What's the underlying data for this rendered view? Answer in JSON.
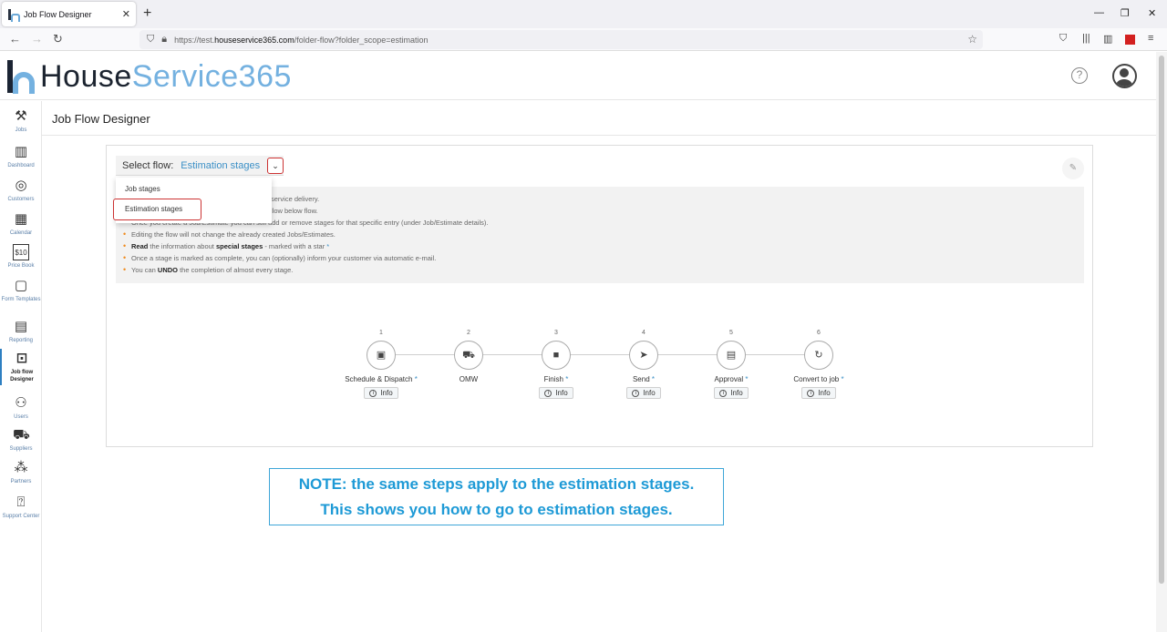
{
  "browser": {
    "tab_title": "Job Flow Designer",
    "tab_close": "✕",
    "new_tab": "+",
    "url_prefix": "https://test.",
    "url_domain": "houseservice365.com",
    "url_path": "/folder-flow?folder_scope=estimation"
  },
  "header": {
    "logo_part1": "House",
    "logo_part2": "Service365",
    "help": "?"
  },
  "sidebar": {
    "items": [
      {
        "label": "Jobs",
        "icon": "tools-icon"
      },
      {
        "label": "Dashboard",
        "icon": "chart-icon"
      },
      {
        "label": "Customers",
        "icon": "target-icon"
      },
      {
        "label": "Calendar",
        "icon": "calendar-icon"
      },
      {
        "label": "Price Book",
        "icon": "price-icon"
      },
      {
        "label": "Form Templates",
        "icon": "form-icon"
      },
      {
        "label": "Reporting",
        "icon": "report-icon"
      },
      {
        "label": "Job flow Designer",
        "icon": "flow-icon"
      },
      {
        "label": "Users",
        "icon": "users-icon"
      },
      {
        "label": "Suppliers",
        "icon": "truck-icon"
      },
      {
        "label": "Partners",
        "icon": "partners-icon"
      },
      {
        "label": "Support Center",
        "icon": "support-icon"
      }
    ]
  },
  "main": {
    "page_title": "Job Flow Designer",
    "select_label": "Select flow:",
    "select_value": "Estimation stages",
    "dropdown_options": [
      "Job stages",
      "Estimation stages"
    ],
    "info_lines": [
      {
        "pre": "",
        "bold": "",
        "post": "service delivery."
      },
      {
        "pre": "",
        "bold": "",
        "post": "llow below flow."
      },
      {
        "pre": "",
        "bold": "",
        "post": "Once you create a Job/Estimate you can still add or remove stages for that specific entry (under Job/Estimate details)."
      },
      {
        "pre": "",
        "bold": "",
        "post": "Editing the flow will not change the already created Jobs/Estimates."
      },
      {
        "pre": "",
        "bold": "Read",
        "post": " the information about ",
        "bold2": "special stages",
        "post2": " - marked with a star ",
        "star": "*"
      },
      {
        "pre": "",
        "bold": "",
        "post": "Once a stage is marked as complete, you can (optionally) inform your customer via automatic e-mail."
      },
      {
        "pre": "You can ",
        "bold": "UNDO",
        "post": " the completion of almost every stage."
      }
    ],
    "info_button": "Info",
    "steps": [
      {
        "num": "1",
        "name": "Schedule & Dispatch",
        "star": "*",
        "glyph": "▣"
      },
      {
        "num": "2",
        "name": "OMW",
        "star": "",
        "glyph": "⛟"
      },
      {
        "num": "3",
        "name": "Finish",
        "star": "*",
        "glyph": "■"
      },
      {
        "num": "4",
        "name": "Send",
        "star": "*",
        "glyph": "➤"
      },
      {
        "num": "5",
        "name": "Approval",
        "star": "*",
        "glyph": "▤"
      },
      {
        "num": "6",
        "name": "Convert to job",
        "star": "*",
        "glyph": "↻"
      }
    ]
  },
  "note": {
    "line1": "NOTE: the same steps apply to the estimation stages.",
    "line2": "This shows you how to go to estimation stages."
  }
}
